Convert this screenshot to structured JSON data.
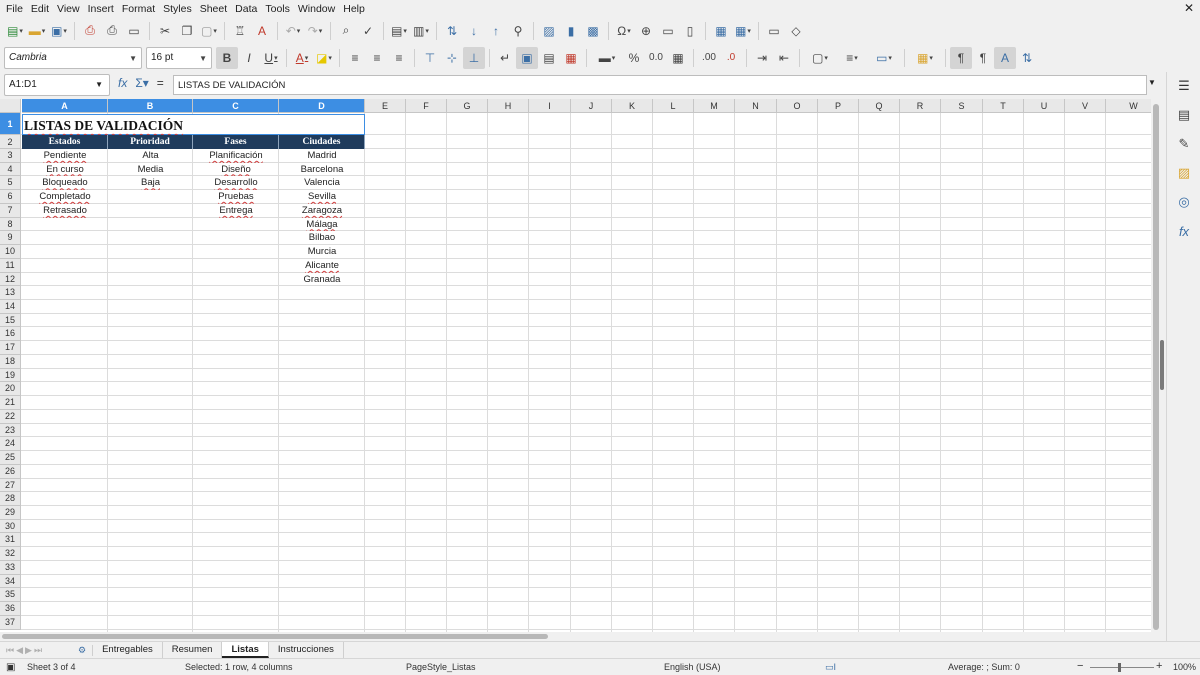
{
  "menu": [
    "File",
    "Edit",
    "View",
    "Insert",
    "Format",
    "Styles",
    "Sheet",
    "Data",
    "Tools",
    "Window",
    "Help"
  ],
  "font": {
    "name": "Cambria",
    "size": "16 pt"
  },
  "name_box": "A1:D1",
  "formula": "LISTAS DE VALIDACIÓN",
  "columns": [
    "A",
    "B",
    "C",
    "D",
    "E",
    "F",
    "G",
    "H",
    "I",
    "J",
    "K",
    "L",
    "M",
    "N",
    "O",
    "P",
    "Q",
    "R",
    "S",
    "T",
    "U",
    "V",
    "W"
  ],
  "rows": [
    "1",
    "2",
    "3",
    "4",
    "5",
    "6",
    "7",
    "8",
    "9",
    "10",
    "11",
    "12",
    "13",
    "14",
    "15",
    "16",
    "17",
    "18",
    "19",
    "20",
    "21",
    "22",
    "23",
    "24",
    "25",
    "26",
    "27",
    "28",
    "29",
    "30",
    "31",
    "32",
    "33",
    "34",
    "35",
    "36",
    "37"
  ],
  "sheet": {
    "title": "LISTAS DE VALIDACIÓN",
    "headers": [
      "Estados",
      "Prioridad",
      "Fases",
      "Ciudades"
    ],
    "estados": [
      "Pendiente",
      "En curso",
      "Bloqueado",
      "Completado",
      "Retrasado"
    ],
    "prioridad": [
      "Alta",
      "Media",
      "Baja"
    ],
    "fases": [
      "Planificación",
      "Diseño",
      "Desarrollo",
      "Pruebas",
      "Entrega"
    ],
    "ciudades": [
      "Madrid",
      "Barcelona",
      "Valencia",
      "Sevilla",
      "Zaragoza",
      "Málaga",
      "Bilbao",
      "Murcia",
      "Alicante",
      "Granada"
    ]
  },
  "tabs": [
    "Entregables",
    "Resumen",
    "Listas",
    "Instrucciones"
  ],
  "active_tab": "Listas",
  "status": {
    "sheet": "Sheet 3 of 4",
    "selection": "Selected: 1 row, 4 columns",
    "page_style": "PageStyle_Listas",
    "language": "English (USA)",
    "summary": "Average: ; Sum: 0",
    "zoom": "100%"
  },
  "colors": {
    "header_bg": "#1f3b5c",
    "selection": "#3d8ee3"
  }
}
